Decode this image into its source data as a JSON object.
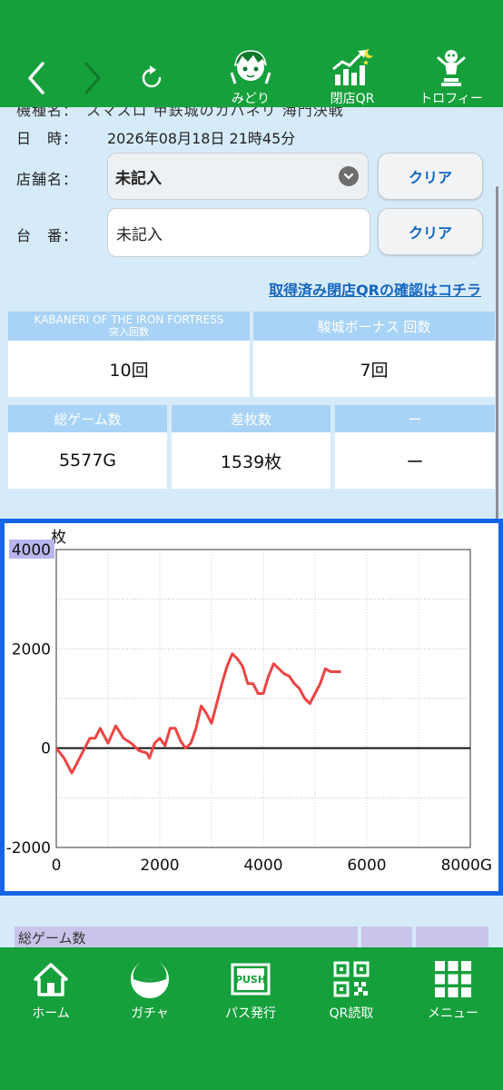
{
  "header": {
    "back_icon": "chevron-left-icon",
    "forward_icon": "chevron-right-icon",
    "reload_icon": "reload-icon",
    "items": [
      {
        "label": "みどり",
        "icon": "character-avatar-icon"
      },
      {
        "label": "閉店QR",
        "icon": "chart-growth-icon"
      },
      {
        "label": "トロフィー",
        "icon": "trophy-figure-icon"
      }
    ]
  },
  "info": {
    "machine_label_cut": "機種名：　スマスロ 甲鉄城のカバネリ 海門決戦",
    "datetime_label": "日　時：",
    "datetime_value": "2026年08月18日 21時45分",
    "store_label": "店舗名：",
    "store_value": "未記入",
    "unit_label": "台　番：",
    "unit_value": "未記入",
    "clear_label": "クリア",
    "qr_link": "取得済み閉店QRの確認はコチラ"
  },
  "stats": {
    "row1": [
      {
        "title": "KABANERI OF THE IRON FORTRESS",
        "subtitle": "突入回数",
        "value": "10回"
      },
      {
        "title": "駿城ボーナス 回数",
        "subtitle": "",
        "value": "7回"
      }
    ],
    "row2": [
      {
        "title": "総ゲーム数",
        "value": "5577G"
      },
      {
        "title": "差枚数",
        "value": "1539枚"
      },
      {
        "title": "ー",
        "value": "ー"
      }
    ]
  },
  "chart_data": {
    "type": "line",
    "title": "",
    "ylabel": "枚",
    "xlabel": "",
    "xlim": [
      0,
      8000
    ],
    "ylim": [
      -2000,
      4000
    ],
    "xticks": [
      "0",
      "2000",
      "4000",
      "6000",
      "8000G"
    ],
    "yticks": [
      "4000",
      "2000",
      "0",
      "-2000"
    ],
    "grid": true,
    "color": "#ee4444",
    "x": [
      0,
      150,
      300,
      450,
      550,
      650,
      750,
      850,
      1000,
      1150,
      1300,
      1450,
      1600,
      1750,
      1800,
      1900,
      2000,
      2100,
      2200,
      2300,
      2400,
      2500,
      2600,
      2700,
      2800,
      2900,
      3000,
      3100,
      3200,
      3300,
      3400,
      3500,
      3600,
      3700,
      3800,
      3900,
      4000,
      4100,
      4200,
      4300,
      4400,
      4500,
      4600,
      4700,
      4800,
      4900,
      5000,
      5100,
      5200,
      5300,
      5400,
      5500
    ],
    "y": [
      0,
      -200,
      -500,
      -200,
      0,
      200,
      200,
      400,
      100,
      450,
      200,
      100,
      -50,
      -100,
      -200,
      100,
      200,
      50,
      400,
      400,
      150,
      0,
      100,
      400,
      850,
      700,
      500,
      900,
      1300,
      1650,
      1900,
      1800,
      1650,
      1300,
      1300,
      1100,
      1100,
      1450,
      1700,
      1600,
      1500,
      1450,
      1300,
      1200,
      1000,
      900,
      1100,
      1300,
      1600,
      1539,
      1539,
      1539
    ]
  },
  "bottom_nav": [
    {
      "label": "ホーム",
      "icon": "home-icon"
    },
    {
      "label": "ガチャ",
      "icon": "gacha-ball-icon"
    },
    {
      "label": "パス発行",
      "icon": "push-pass-icon"
    },
    {
      "label": "QR読取",
      "icon": "qr-code-icon"
    },
    {
      "label": "メニュー",
      "icon": "menu-grid-icon"
    }
  ],
  "under_content": {
    "partial_label": "総ゲーム数"
  },
  "colors": {
    "brand_green": "#16a03c",
    "background": "#d6ebfa",
    "table_header": "#a8d3f6",
    "link_blue": "#1565c0",
    "graph_frame": "#1565e8",
    "line_red": "#ee4444"
  }
}
